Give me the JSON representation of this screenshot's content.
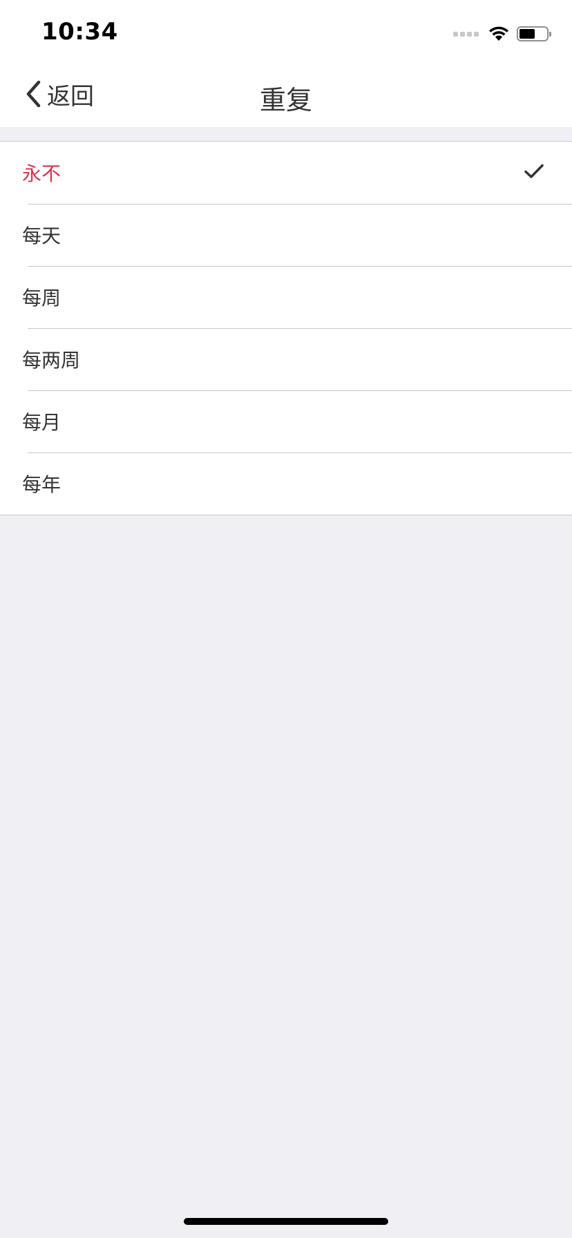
{
  "status_bar": {
    "time": "10:34",
    "icons": [
      "signal-icon",
      "wifi-icon",
      "battery-icon"
    ]
  },
  "nav": {
    "back_label": "返回",
    "back_icon": "chevron-left-icon",
    "title": "重复"
  },
  "repeat_options": [
    {
      "label": "永不",
      "selected": true
    },
    {
      "label": "每天",
      "selected": false
    },
    {
      "label": "每周",
      "selected": false
    },
    {
      "label": "每两周",
      "selected": false
    },
    {
      "label": "每月",
      "selected": false
    },
    {
      "label": "每年",
      "selected": false
    }
  ],
  "selected_check_icon": "checkmark-icon",
  "colors": {
    "accent": "#e0304e",
    "text": "#333333",
    "background": "#efeff4",
    "separator": "#c8c7cc"
  }
}
